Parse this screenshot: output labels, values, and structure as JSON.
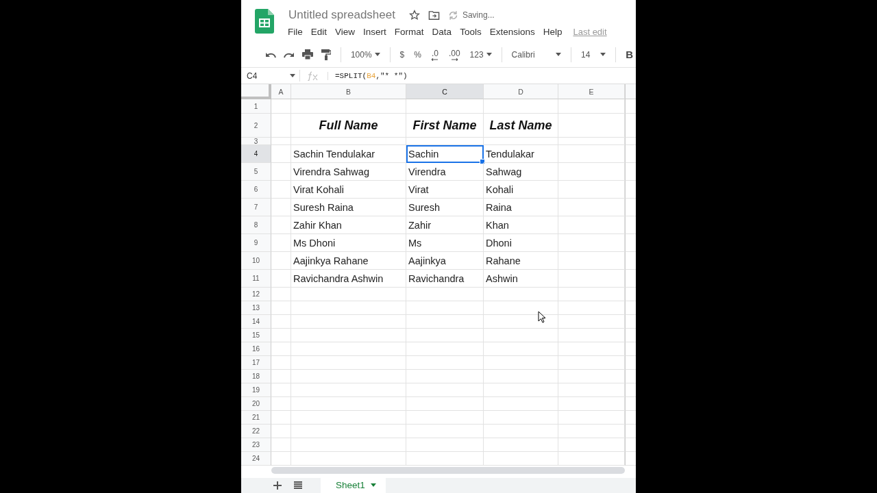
{
  "title": "Untitled spreadsheet",
  "save_status": "Saving...",
  "menu": [
    "File",
    "Edit",
    "View",
    "Insert",
    "Format",
    "Data",
    "Tools",
    "Extensions",
    "Help"
  ],
  "last_edit": "Last edit",
  "toolbar": {
    "zoom": "100%",
    "format_buttons": [
      {
        "label": "$",
        "kind": "plain"
      },
      {
        "label": "%",
        "kind": "plain"
      },
      {
        "label": ".0",
        "kind": "decrease"
      },
      {
        "label": ".00",
        "kind": "increase"
      },
      {
        "label": "123",
        "kind": "dropdown"
      }
    ],
    "font": "Calibri",
    "font_size": "14",
    "bold": "B"
  },
  "name_box": "C4",
  "formula": [
    {
      "text": "=SPLIT(",
      "kind": "plain"
    },
    {
      "text": "B4",
      "kind": "ref"
    },
    {
      "text": ",\"* *\")",
      "kind": "plain"
    }
  ],
  "columns": [
    {
      "label": "A",
      "selected": false
    },
    {
      "label": "B",
      "selected": false
    },
    {
      "label": "C",
      "selected": true
    },
    {
      "label": "D",
      "selected": false
    },
    {
      "label": "E",
      "selected": false
    }
  ],
  "rows": [
    {
      "number": "1",
      "selected": false,
      "kind": "blank"
    },
    {
      "number": "2",
      "selected": false,
      "kind": "heading",
      "cells": [
        {
          "text": "Full Name",
          "selected": false
        },
        {
          "text": "First Name",
          "selected": false
        },
        {
          "text": "Last Name",
          "selected": false
        }
      ]
    },
    {
      "number": "3",
      "selected": false,
      "kind": "blank"
    },
    {
      "number": "4",
      "selected": true,
      "kind": "data",
      "cells": [
        {
          "text": "Sachin Tendulakar",
          "selected": false
        },
        {
          "text": "Sachin",
          "selected": true
        },
        {
          "text": "Tendulakar",
          "selected": false
        }
      ]
    },
    {
      "number": "5",
      "selected": false,
      "kind": "data",
      "cells": [
        {
          "text": "Virendra Sahwag",
          "selected": false
        },
        {
          "text": "Virendra",
          "selected": false
        },
        {
          "text": "Sahwag",
          "selected": false
        }
      ]
    },
    {
      "number": "6",
      "selected": false,
      "kind": "data",
      "cells": [
        {
          "text": "Virat Kohali",
          "selected": false
        },
        {
          "text": "Virat",
          "selected": false
        },
        {
          "text": "Kohali",
          "selected": false
        }
      ]
    },
    {
      "number": "7",
      "selected": false,
      "kind": "data",
      "cells": [
        {
          "text": "Suresh Raina",
          "selected": false
        },
        {
          "text": "Suresh",
          "selected": false
        },
        {
          "text": "Raina",
          "selected": false
        }
      ]
    },
    {
      "number": "8",
      "selected": false,
      "kind": "data",
      "cells": [
        {
          "text": "Zahir Khan",
          "selected": false
        },
        {
          "text": "Zahir",
          "selected": false
        },
        {
          "text": "Khan",
          "selected": false
        }
      ]
    },
    {
      "number": "9",
      "selected": false,
      "kind": "data",
      "cells": [
        {
          "text": "Ms Dhoni",
          "selected": false
        },
        {
          "text": "Ms",
          "selected": false
        },
        {
          "text": "Dhoni",
          "selected": false
        }
      ]
    },
    {
      "number": "10",
      "selected": false,
      "kind": "data",
      "cells": [
        {
          "text": "Aajinkya Rahane",
          "selected": false
        },
        {
          "text": "Aajinkya",
          "selected": false
        },
        {
          "text": "Rahane",
          "selected": false
        }
      ]
    },
    {
      "number": "11",
      "selected": false,
      "kind": "data",
      "cells": [
        {
          "text": "Ravichandra Ashwin",
          "selected": false
        },
        {
          "text": "Ravichandra",
          "selected": false
        },
        {
          "text": "Ashwin",
          "selected": false
        }
      ]
    },
    {
      "number": "12",
      "selected": false,
      "kind": "blank"
    },
    {
      "number": "13",
      "selected": false,
      "kind": "blank"
    },
    {
      "number": "14",
      "selected": false,
      "kind": "blank"
    },
    {
      "number": "15",
      "selected": false,
      "kind": "blank"
    },
    {
      "number": "16",
      "selected": false,
      "kind": "blank"
    },
    {
      "number": "17",
      "selected": false,
      "kind": "blank"
    },
    {
      "number": "18",
      "selected": false,
      "kind": "blank"
    },
    {
      "number": "19",
      "selected": false,
      "kind": "blank"
    },
    {
      "number": "20",
      "selected": false,
      "kind": "blank"
    },
    {
      "number": "21",
      "selected": false,
      "kind": "blank"
    },
    {
      "number": "22",
      "selected": false,
      "kind": "blank"
    },
    {
      "number": "23",
      "selected": false,
      "kind": "blank"
    },
    {
      "number": "24",
      "selected": false,
      "kind": "blank"
    }
  ],
  "sheets": [
    {
      "name": "Sheet1",
      "selected": true
    }
  ]
}
